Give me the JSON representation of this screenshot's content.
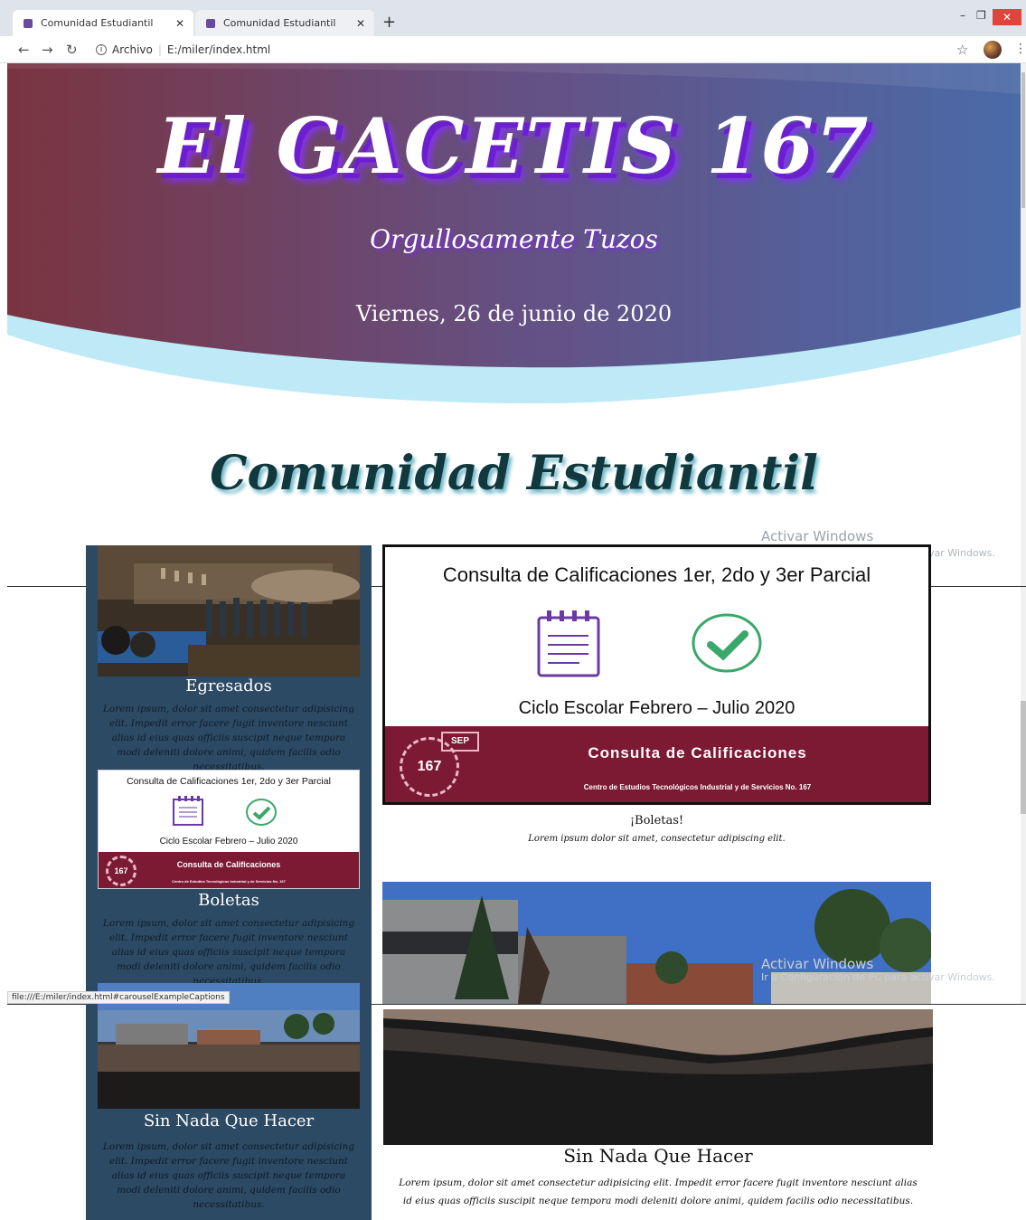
{
  "browser": {
    "tabs": [
      {
        "label": "Comunidad Estudiantil"
      },
      {
        "label": "Comunidad Estudiantil"
      }
    ],
    "address": {
      "security_label": "Archivo",
      "url": "E:/miler/index.html"
    },
    "status_url": "file:///E:/miler/index.html#carouselExampleCaptions"
  },
  "header": {
    "title": "El GACETIS 167",
    "subtitle": "Orgullosamente Tuzos",
    "date": "Viernes, 26 de junio de 2020"
  },
  "section_title": "Comunidad Estudiantil",
  "watermark": {
    "line1": "Activar Windows",
    "line2": "Ir a Configuración de PC para activar Windows."
  },
  "sidebar": {
    "cards": [
      {
        "title": "Egresados",
        "text": "Lorem ipsum, dolor sit amet consectetur adipisicing elit. Impedit error facere fugit inventore nesciunt alias id eius quas officiis suscipit neque tempora modi deleniti dolore animi, quidem facilis odio necessitatibus."
      },
      {
        "title": "Boletas",
        "text": "Lorem ipsum, dolor sit amet consectetur adipisicing elit. Impedit error facere fugit inventore nesciunt alias id eius quas officiis suscipit neque tempora modi deleniti dolore animi, quidem facilis odio necessitatibus."
      },
      {
        "title": "Sin Nada Que Hacer",
        "text": "Lorem ipsum, dolor sit amet consectetur adipisicing elit. Impedit error facere fugit inventore nesciunt alias id eius quas officiis suscipit neque tempora modi deleniti dolore animi, quidem facilis odio necessitatibus."
      }
    ]
  },
  "consulta": {
    "heading": "Consulta de Calificaciones 1er, 2do y 3er Parcial",
    "cycle": "Ciclo Escolar Febrero – Julio 2020",
    "band_title": "Consulta de Calificaciones",
    "band_sub": "Centro de Estudios Tecnológicos Industrial y de Servicios No. 167",
    "badge_top": "SEP",
    "badge_num": "167"
  },
  "main": {
    "slide1": {
      "caption": "¡Boletas!",
      "text": "Lorem ipsum dolor sit amet, consectetur adipiscing elit."
    },
    "slide2": {
      "caption": "Sin Nada Que Hacer",
      "text": "Lorem ipsum, dolor sit amet consectetur adipisicing elit. Impedit error facere fugit inventore nesciunt alias id eius quas officiis suscipit neque tempora modi deleniti dolore animi, quidem facilis odio necessitatibus."
    }
  },
  "colors": {
    "sidebar": "#2d4a64",
    "band": "#7b1a32",
    "hero_left": "#7a3440",
    "hero_right": "#4a6aa8",
    "wave": "#bdeaf6"
  }
}
